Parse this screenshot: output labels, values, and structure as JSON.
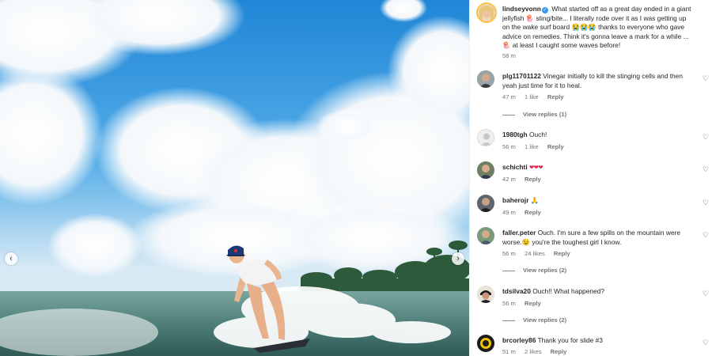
{
  "post": {
    "author": "lindseyvonn",
    "caption": "What started off as a great day ended in a giant jellyfish 🪼 sting/bite... I literally rode over it as I was getting up on the wake surf board 😭😭😭 thanks to everyone who gave advice on remedies. Think it's gonna leave a mark for a while ... 🪼 at least I caught some waves before!",
    "time": "58 m"
  },
  "carousel": {
    "prev_icon": "‹",
    "next_icon": "›"
  },
  "comments": [
    {
      "user": "plg11701122",
      "text": "Vinegar initially to kill the stinging cells and then yeah just time for it to heal.",
      "time": "47 m",
      "likes": "1 like",
      "reply": "Reply",
      "view_replies": "View replies (1)"
    },
    {
      "user": "1980tgh",
      "text": "Ouch!",
      "time": "56 m",
      "likes": "1 like",
      "reply": "Reply"
    },
    {
      "user": "schichti",
      "text": "❤❤❤",
      "time": "42 m",
      "reply": "Reply"
    },
    {
      "user": "baherojr",
      "text": "🙏",
      "time": "49 m",
      "reply": "Reply"
    },
    {
      "user": "faller.peter",
      "text": "Ouch. I'm sure a few spills on the mountain were worse.😉 you're the toughest girl I know.",
      "time": "56 m",
      "likes": "24 likes",
      "reply": "Reply",
      "view_replies": "View replies (2)"
    },
    {
      "user": "tdsilva20",
      "text": "Ouch!! What happened?",
      "time": "56 m",
      "reply": "Reply",
      "view_replies": "View replies (2)"
    },
    {
      "user": "brcorley86",
      "text": "Thank you for slide #3",
      "time": "51 m",
      "likes": "2 likes",
      "reply": "Reply"
    }
  ],
  "icons": {
    "heart": "♡",
    "verified": "✓"
  },
  "colors": {
    "verified_blue": "#3897f0",
    "meta_gray": "#737373",
    "text": "#262626"
  }
}
